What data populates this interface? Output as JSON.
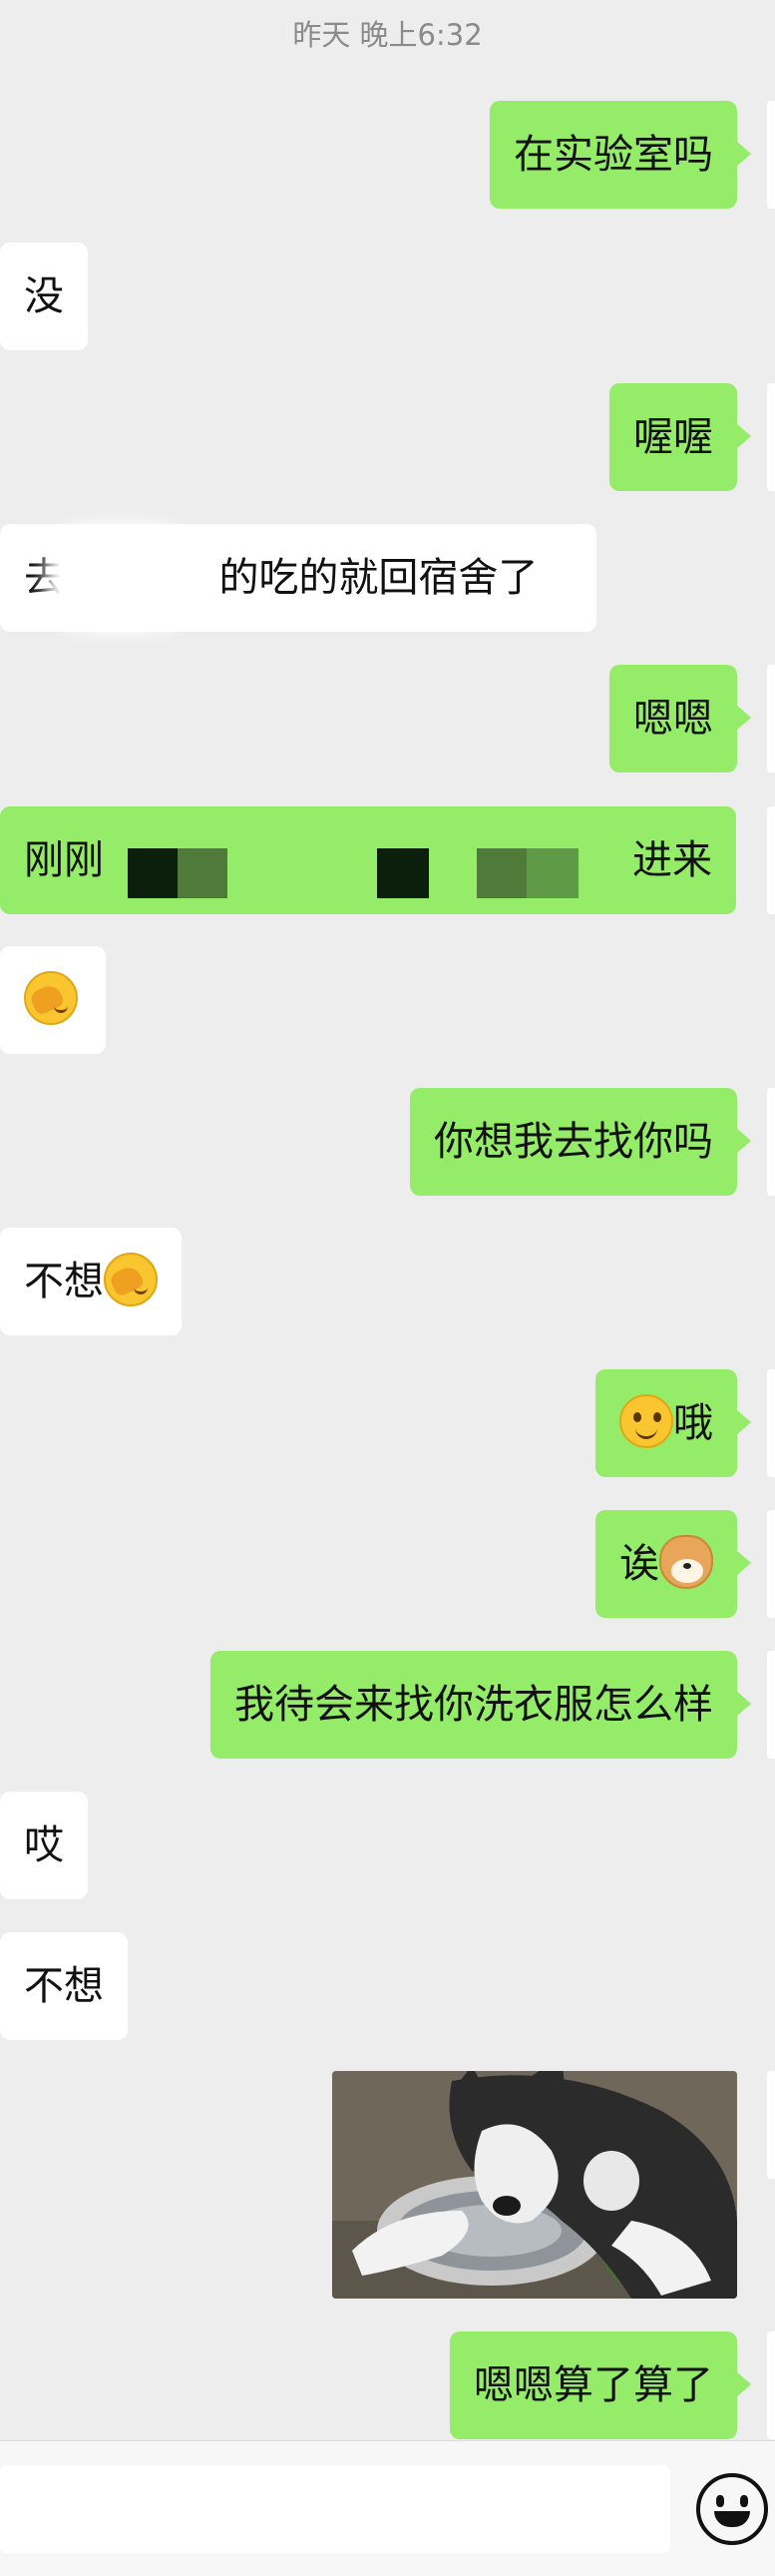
{
  "chat": {
    "timestamp": "昨天 晚上6:32",
    "messages": [
      {
        "sender": "me",
        "text": "在实验室吗"
      },
      {
        "sender": "them",
        "text": "没"
      },
      {
        "sender": "me",
        "text": "喔喔"
      },
      {
        "sender": "them",
        "text_before_redaction": "去",
        "text_after_redaction": "的吃的就回宿舍了"
      },
      {
        "sender": "me",
        "text": "嗯嗯"
      },
      {
        "sender": "them",
        "text_before_redaction": "刚刚",
        "text_after_redaction": "进来",
        "style": "highlighted-green"
      },
      {
        "sender": "them",
        "emoji": "facepalm-emoji"
      },
      {
        "sender": "me",
        "text": "你想我去找你吗"
      },
      {
        "sender": "them",
        "text": "不想",
        "emoji": "facepalm-emoji"
      },
      {
        "sender": "me",
        "emoji": "smile-emoji",
        "text": "哦"
      },
      {
        "sender": "me",
        "text": "诶",
        "emoji": "doge-emoji"
      },
      {
        "sender": "me",
        "text": "我待会来找你洗衣服怎么样"
      },
      {
        "sender": "them",
        "text": "哎"
      },
      {
        "sender": "them",
        "text": "不想"
      },
      {
        "sender": "me",
        "image": "husky-drinking-photo"
      },
      {
        "sender": "me",
        "text": "嗯嗯算了算了"
      }
    ]
  },
  "input_bar": {
    "placeholder": "",
    "emoji_icon": "smiley-icon"
  },
  "colors": {
    "background": "#ededed",
    "my_bubble": "#95ec69",
    "their_bubble": "#ffffff",
    "timestamp": "#8a8a8a"
  }
}
